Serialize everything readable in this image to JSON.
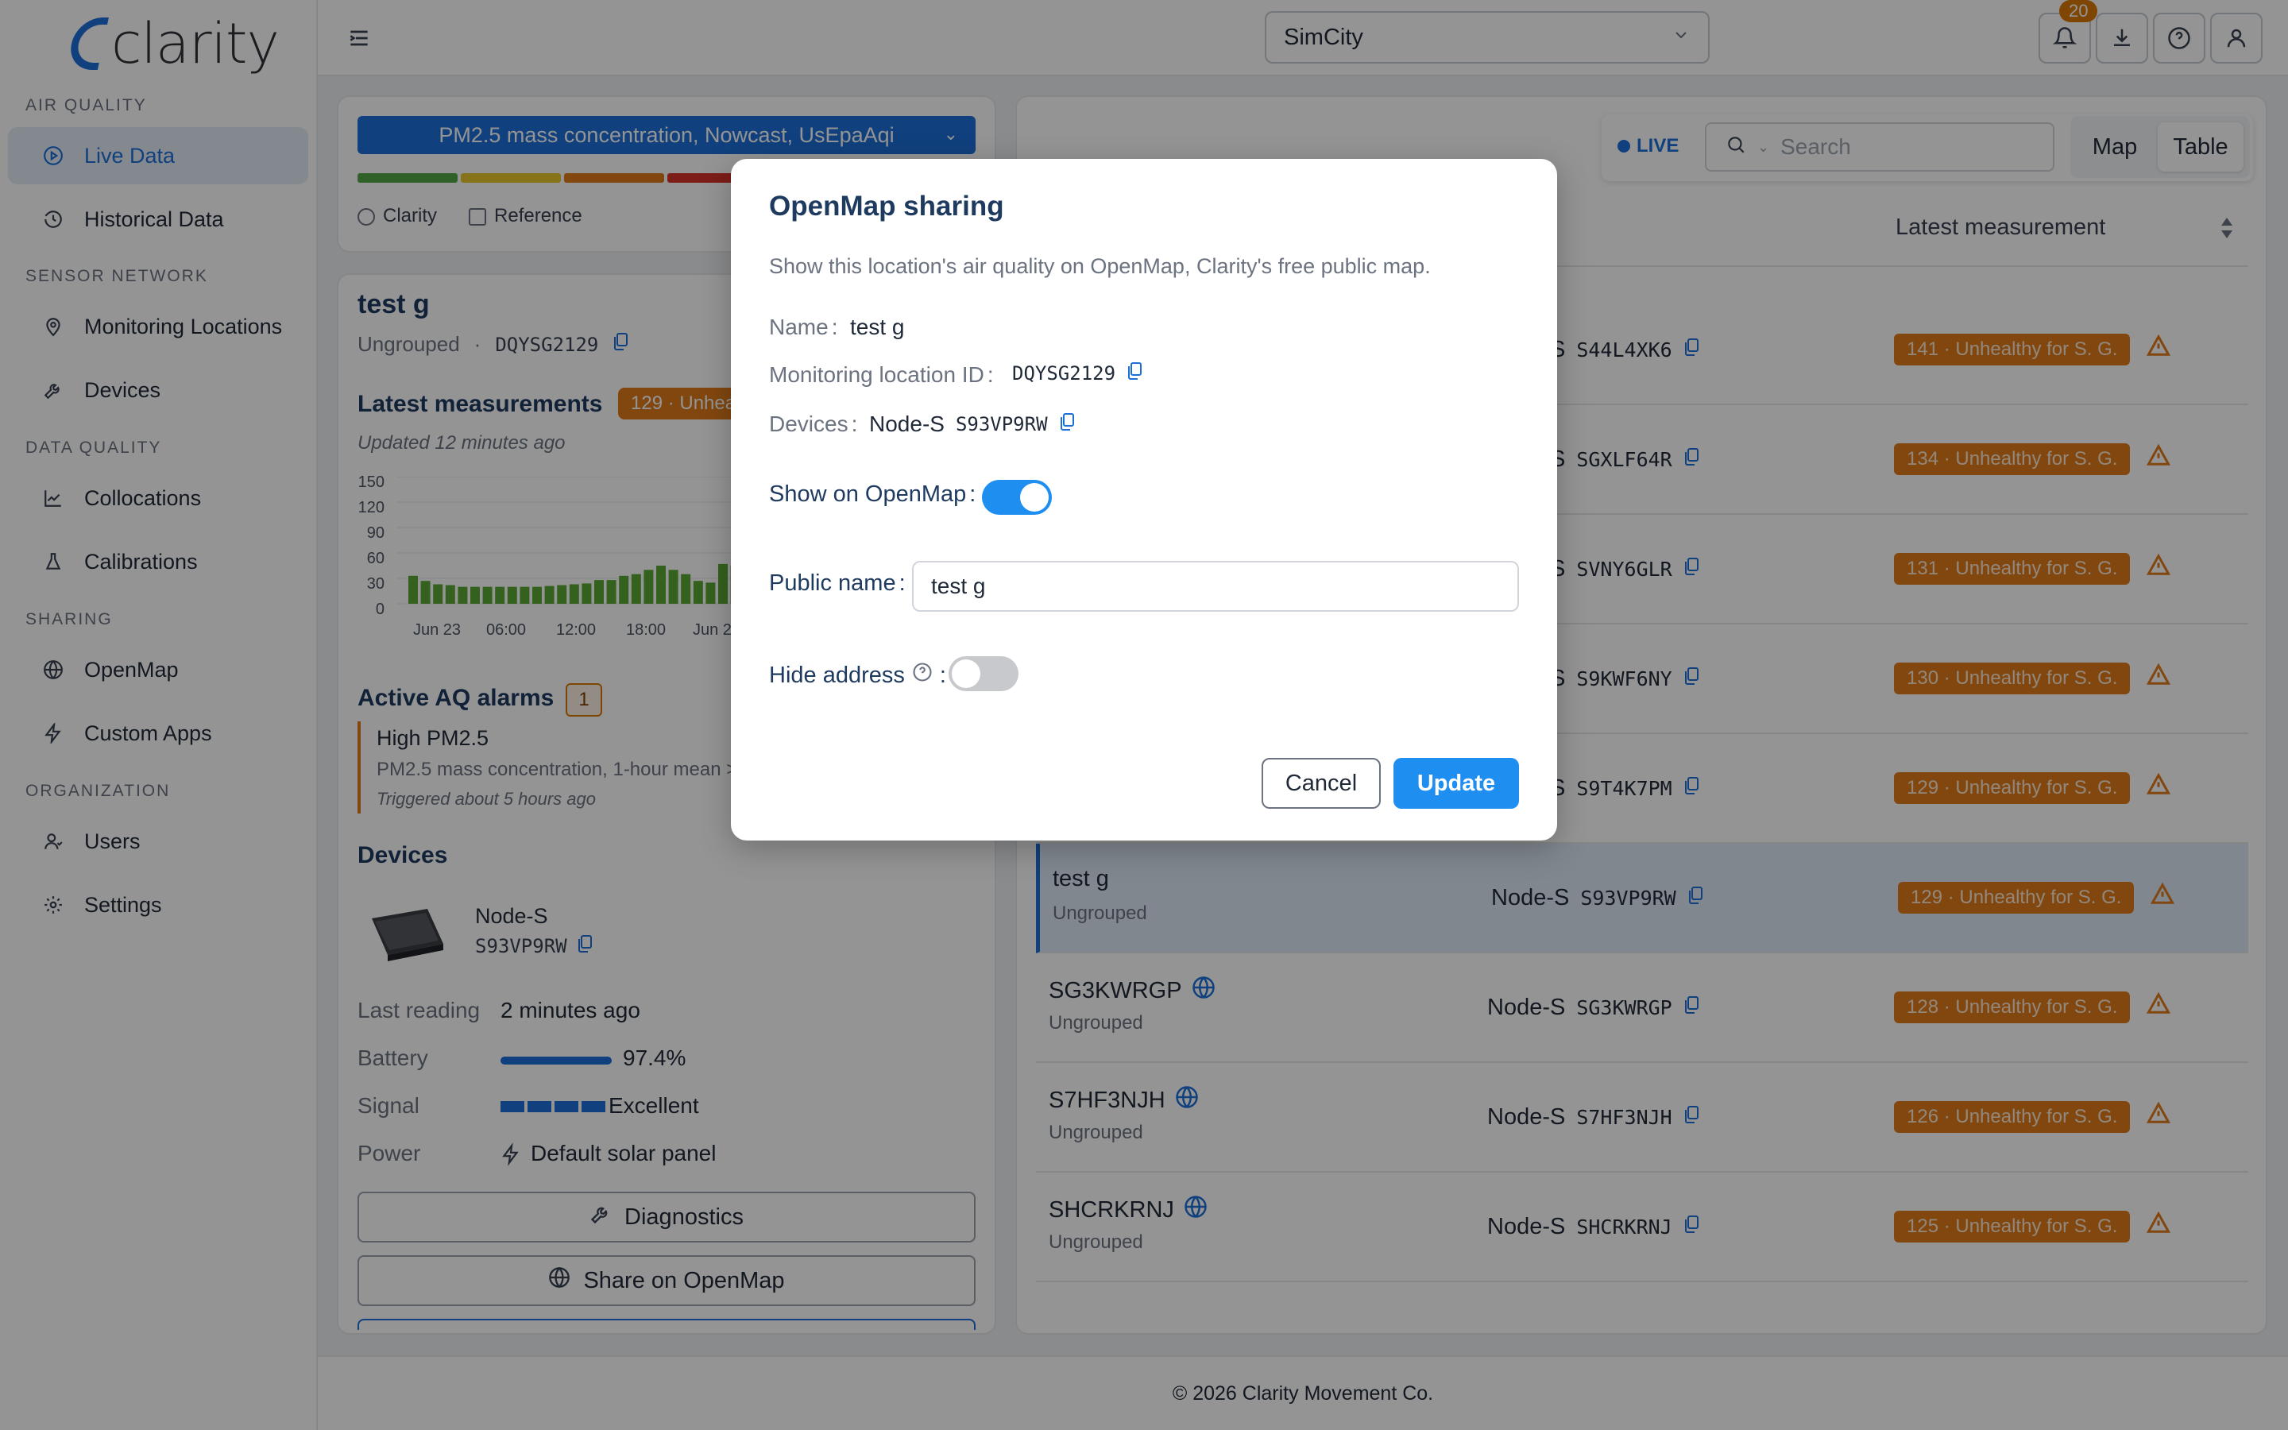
{
  "app": {
    "logo_text": "clarity",
    "footer": "© 2026 Clarity Movement Co."
  },
  "sidebar": {
    "sections": [
      "AIR QUALITY",
      "SENSOR NETWORK",
      "DATA QUALITY",
      "SHARING",
      "ORGANIZATION"
    ],
    "items": [
      {
        "label": "Live Data",
        "icon": "play-circle-icon",
        "active": true
      },
      {
        "label": "Historical Data",
        "icon": "history-icon"
      },
      {
        "label": "Monitoring Locations",
        "icon": "location-pin-icon"
      },
      {
        "label": "Devices",
        "icon": "wrench-icon"
      },
      {
        "label": "Collocations",
        "icon": "line-chart-icon"
      },
      {
        "label": "Calibrations",
        "icon": "flask-icon"
      },
      {
        "label": "OpenMap",
        "icon": "globe-icon"
      },
      {
        "label": "Custom Apps",
        "icon": "bolt-icon"
      },
      {
        "label": "Users",
        "icon": "users-icon"
      },
      {
        "label": "Settings",
        "icon": "gear-icon"
      }
    ]
  },
  "topbar": {
    "org": "SimCity",
    "notifications": "20"
  },
  "left": {
    "metric": "PM2.5 mass concentration, Nowcast, UsEpaAqi",
    "radio_clarity": "Clarity",
    "check_reference": "Reference",
    "location_name": "test g",
    "group": "Ungrouped",
    "location_id": "DQYSG2129",
    "latest_title": "Latest measurements",
    "latest_pill": "129 · Unhea",
    "updated": "Updated 12 minutes ago",
    "alarms_title": "Active AQ alarms",
    "alarms_count": "1",
    "alarm_name": "High PM2.5",
    "alarm_desc": "PM2.5 mass concentration, 1-hour mean >",
    "alarm_time": "Triggered about 5 hours ago",
    "devices_title": "Devices",
    "device_model": "Node-S",
    "device_id": "S93VP9RW",
    "last_reading_label": "Last reading",
    "last_reading": "2 minutes ago",
    "battery_label": "Battery",
    "battery": "97.4%",
    "signal_label": "Signal",
    "signal": "Excellent",
    "power_label": "Power",
    "power": "Default solar panel",
    "diagnostics": "Diagnostics",
    "share": "Share on OpenMap"
  },
  "chart_data": {
    "type": "bar",
    "yticks": [
      "150",
      "120",
      "90",
      "60",
      "30",
      "0"
    ],
    "xticks": [
      "Jun 23",
      "06:00",
      "12:00",
      "18:00",
      "Jun 2"
    ],
    "ylim": [
      0,
      150
    ],
    "values": [
      33,
      27,
      23,
      22,
      20,
      20,
      20,
      20,
      20,
      20,
      20,
      21,
      22,
      23,
      24,
      28,
      28,
      33,
      35,
      40,
      45,
      40,
      35,
      27,
      25,
      47,
      45
    ],
    "color": "#5aa832"
  },
  "right": {
    "live": "LIVE",
    "search_placeholder": "Search",
    "view_map": "Map",
    "view_table": "Table",
    "col_devices_fragment": "s",
    "col_latest": "Latest measurement",
    "rows": [
      {
        "name": "",
        "group": "",
        "device": "Node-S",
        "device_id": "S44L4XK6",
        "aqi": "141 · Unhealthy for S. G."
      },
      {
        "name": "",
        "group": "",
        "device": "Node-S",
        "device_id": "SGXLF64R",
        "aqi": "134 · Unhealthy for S. G."
      },
      {
        "name": "",
        "group": "",
        "device": "Node-S",
        "device_id": "SVNY6GLR",
        "aqi": "131 · Unhealthy for S. G."
      },
      {
        "name": "",
        "group": "",
        "device": "Node-S",
        "device_id": "S9KWF6NY",
        "aqi": "130 · Unhealthy for S. G."
      },
      {
        "name": "",
        "group": "",
        "device": "Node-S",
        "device_id": "S9T4K7PM",
        "aqi": "129 · Unhealthy for S. G."
      },
      {
        "name": "test g",
        "group": "Ungrouped",
        "device": "Node-S",
        "device_id": "S93VP9RW",
        "aqi": "129 · Unhealthy for S. G."
      },
      {
        "name": "SG3KWRGP",
        "group": "Ungrouped",
        "device": "Node-S",
        "device_id": "SG3KWRGP",
        "aqi": "128 · Unhealthy for S. G."
      },
      {
        "name": "S7HF3NJH",
        "group": "Ungrouped",
        "device": "Node-S",
        "device_id": "S7HF3NJH",
        "aqi": "126 · Unhealthy for S. G."
      },
      {
        "name": "SHCRKRNJ",
        "group": "Ungrouped",
        "device": "Node-S",
        "device_id": "SHCRKRNJ",
        "aqi": "125 · Unhealthy for S. G."
      }
    ]
  },
  "modal": {
    "title": "OpenMap sharing",
    "description": "Show this location's air quality on OpenMap, Clarity's free public map.",
    "name_label": "Name",
    "name_value": "test g",
    "loc_id_label": "Monitoring location ID",
    "loc_id_value": "DQYSG2129",
    "devices_label": "Devices",
    "devices_model": "Node-S",
    "devices_id": "S93VP9RW",
    "show_label": "Show on OpenMap",
    "show_on": true,
    "public_name_label": "Public name",
    "public_name_value": "test g",
    "hide_label": "Hide address",
    "hide_on": false,
    "colon": ":",
    "cancel": "Cancel",
    "update": "Update"
  }
}
